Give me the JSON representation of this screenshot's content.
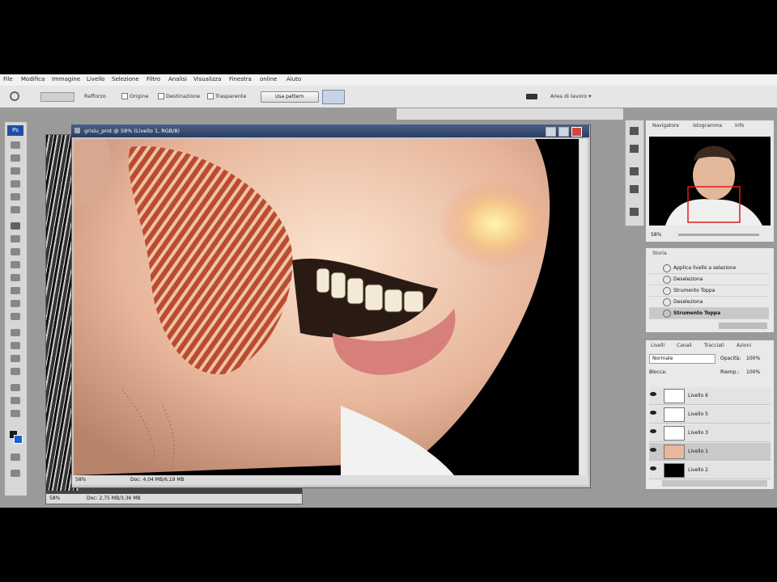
{
  "menu": [
    "File",
    "Modifica",
    "Immagine",
    "Livello",
    "Selezione",
    "Filtro",
    "Analisi",
    "Visualizza",
    "Finestra",
    "online",
    "Aiuto"
  ],
  "options_bar": {
    "sample": "Rafforzo",
    "origine": "Origine",
    "destinazione": "Destinazione",
    "trasparente": "Trasparente",
    "pattern_button": "Usa pattern",
    "workspace": "Area di lavoro"
  },
  "document": {
    "title": "grisiu_prot @ 58% (Livello 1, RGB/8)",
    "zoom": "58%",
    "doc_size": "Doc: 4,04 MB/6,19 MB"
  },
  "document_back": {
    "zoom": "58%",
    "doc_size": "Doc: 2,75 MB/3,36 MB"
  },
  "navigator": {
    "tabs": [
      "Navigatore",
      "Istogramma",
      "Info"
    ],
    "zoom": "58%"
  },
  "history": {
    "tab": "Storia",
    "items": [
      "Applica livello a selezione",
      "Deseleziona",
      "Strumento Toppa",
      "Deseleziona",
      "Strumento Toppa"
    ]
  },
  "layers": {
    "tabs": [
      "Livelli",
      "Canali",
      "Tracciati",
      "Azioni"
    ],
    "blend_mode": "Normale",
    "opacity_label": "Opacità:",
    "opacity_value": "100%",
    "fill_label": "Riemp.:",
    "fill_value": "100%",
    "blocca": "Blocca:",
    "items": [
      {
        "name": "Livello 6",
        "active": false,
        "thumb": "#ffffff"
      },
      {
        "name": "Livello 5",
        "active": false,
        "thumb": "#ffffff"
      },
      {
        "name": "Livello 3",
        "active": false,
        "thumb": "#ffffff"
      },
      {
        "name": "Livello 1",
        "active": true,
        "thumb": "#e9b89c"
      },
      {
        "name": "Livello 2",
        "active": false,
        "thumb": "#000000"
      }
    ]
  },
  "colors": {
    "titlebar": "#2c3d5e",
    "active_layer": "#c9c9c9",
    "selected_history": "#c8c8c8"
  }
}
